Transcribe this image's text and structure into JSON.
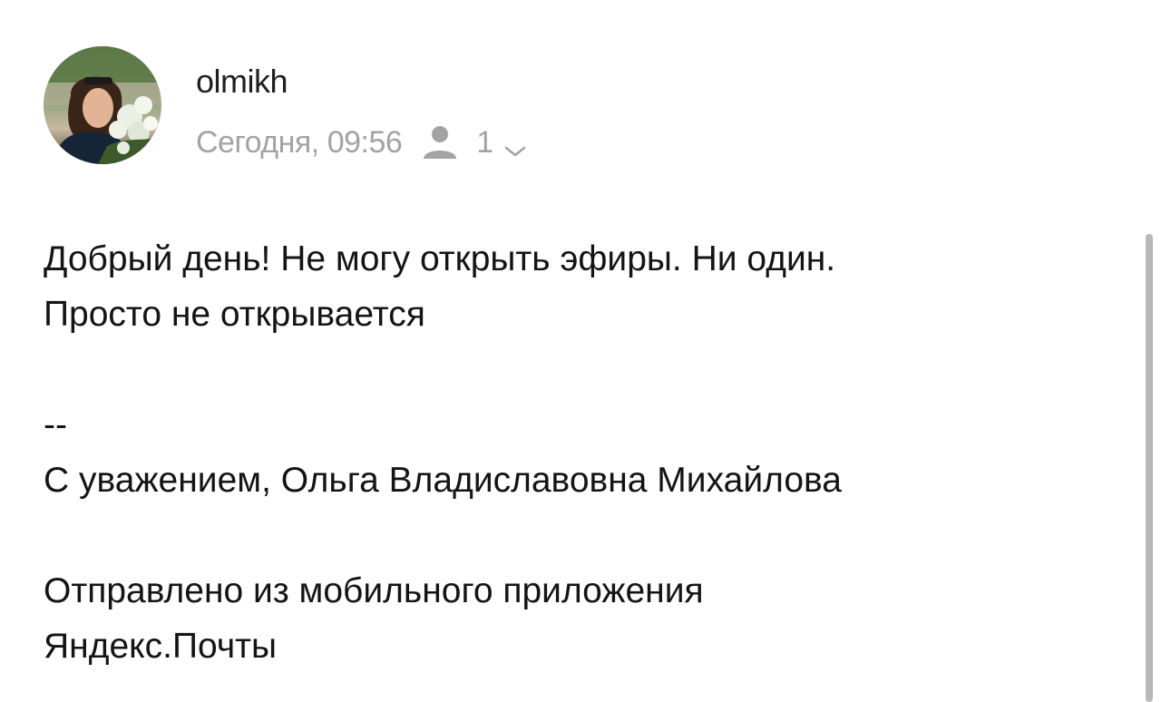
{
  "message": {
    "sender": "olmikh",
    "date": "Сегодня, 09:56",
    "recipients_count": "1",
    "body_lines": [
      "Добрый день! Не могу открыть эфиры. Ни один.",
      "Просто не открывается"
    ],
    "signature_separator": "--",
    "signature": "С уважением, Ольга Владиславовна Михайлова",
    "footer_lines": [
      "Отправлено из мобильного приложения",
      "Яндекс.Почты"
    ]
  },
  "icons": {
    "recipients": "person-icon",
    "expand": "chevron-down-icon"
  },
  "colors": {
    "text": "#141414",
    "meta": "#a3a3a3",
    "scrollbar": "#b9b9b9"
  }
}
